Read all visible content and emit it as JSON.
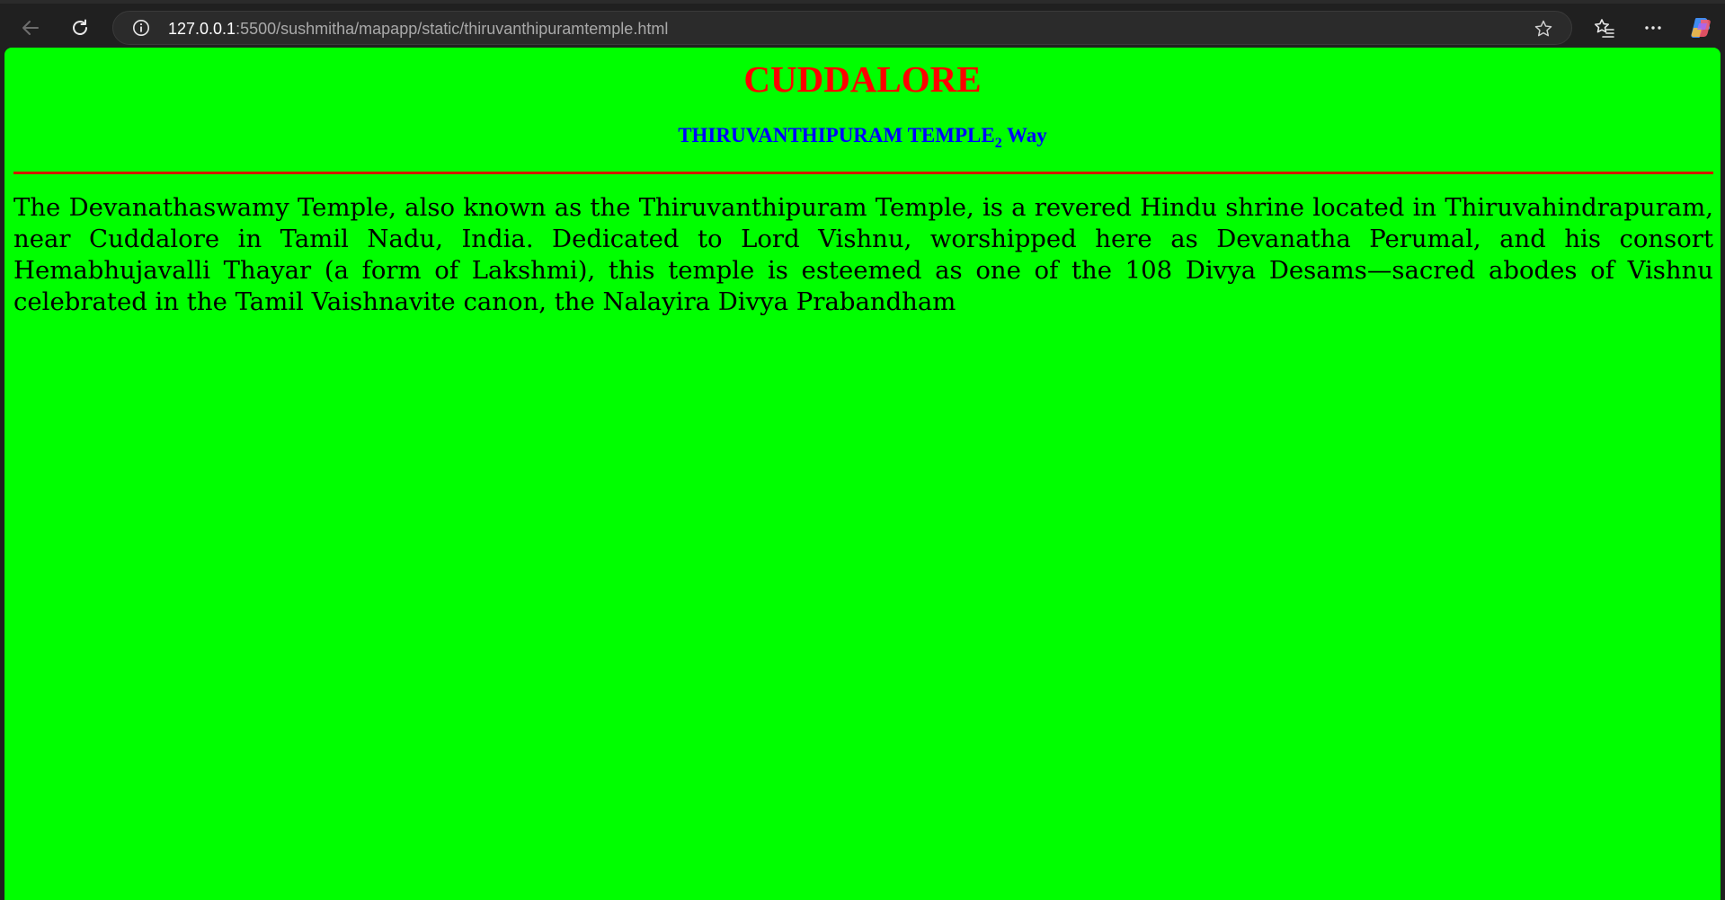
{
  "browser": {
    "url_host": "127.0.0.1",
    "url_path": ":5500/sushmitha/mapapp/static/thiruvanthipuramtemple.html",
    "icons": {
      "back": "arrow-left-icon",
      "reload": "reload-icon",
      "info": "info-icon",
      "favorite": "star-icon",
      "favorites": "favorites-icon",
      "more": "more-icon",
      "copilot": "copilot-icon"
    }
  },
  "page": {
    "background_color": "#00ff00",
    "title": "CUDDALORE",
    "title_color": "#ff0000",
    "subtitle_main": "THIRUVANTHIPURAM TEMPLE",
    "subtitle_sub": "2",
    "subtitle_suffix": " Way",
    "subtitle_color": "#0000ff",
    "divider_color": "#d11a00",
    "body": "The Devanathaswamy Temple, also known as the Thiruvanthipuram Temple, is a revered Hindu shrine located in Thiruvahindrapuram, near Cuddalore in Tamil Nadu, India. Dedicated to Lord Vishnu, worshipped here as Devanatha Perumal, and his consort Hemabhujavalli Thayar (a form of Lakshmi), this temple is esteemed as one of the 108 Divya Desams—sacred abodes of Vishnu celebrated in the Tamil Vaishnavite canon, the Nalayira Divya Prabandham"
  }
}
